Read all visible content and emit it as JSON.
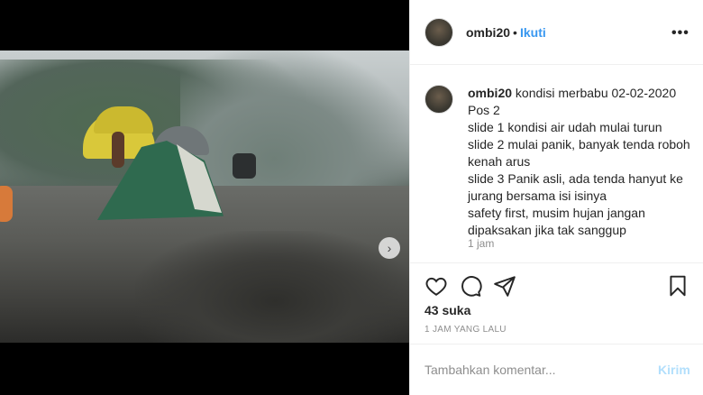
{
  "media": {
    "carousel_total": 3,
    "carousel_active": 2,
    "next_glyph": "›"
  },
  "header": {
    "username": "ombi20",
    "separator": "•",
    "follow_label": "Ikuti",
    "more_glyph": "•••"
  },
  "caption": {
    "username": "ombi20",
    "lines": [
      "kondisi merbabu 02-02-2020",
      "Pos 2",
      "slide 1 kondisi air udah mulai turun",
      "slide 2 mulai panik, banyak tenda roboh kenah arus",
      "slide 3 Panik asli, ada tenda hanyut ke jurang bersama isi isinya",
      "safety first, musim hujan jangan dipaksakan jika tak sanggup"
    ],
    "time": "1 jam"
  },
  "actions": {
    "icons": [
      "heart-icon",
      "comment-icon",
      "share-icon",
      "bookmark-icon"
    ],
    "likes": "43 suka",
    "posted_ago": "1 JAM YANG LALU"
  },
  "comment": {
    "placeholder": "Tambahkan komentar...",
    "send_label": "Kirim"
  },
  "colors": {
    "accent": "#3897f0",
    "send_disabled": "#b2dffc",
    "text": "#262626",
    "muted": "#8e8e8e"
  }
}
